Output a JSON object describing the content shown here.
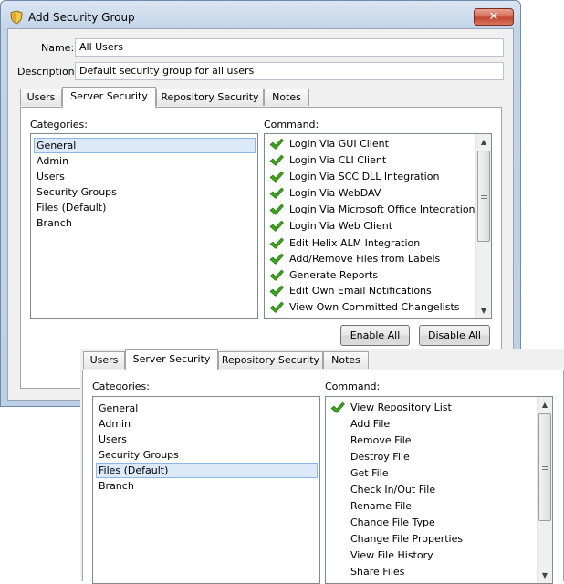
{
  "window": {
    "title": "Add Security Group",
    "close_glyph": "✕",
    "icon": "shield-icon"
  },
  "form": {
    "name_label": "Name:",
    "name_value": "All Users",
    "description_label": "Description:",
    "description_value": "Default security group for all users"
  },
  "tabs": [
    "Users",
    "Server Security",
    "Repository Security",
    "Notes"
  ],
  "active_tab": "Server Security",
  "panel": {
    "categories_label": "Categories:",
    "command_label": "Command:"
  },
  "main_view": {
    "categories": [
      "General",
      "Admin",
      "Users",
      "Security Groups",
      "Files (Default)",
      "Branch"
    ],
    "selected_category": "General",
    "commands": [
      {
        "label": "Login Via GUI Client",
        "checked": true
      },
      {
        "label": "Login Via CLI Client",
        "checked": true
      },
      {
        "label": "Login Via SCC DLL Integration",
        "checked": true
      },
      {
        "label": "Login Via WebDAV",
        "checked": true
      },
      {
        "label": "Login Via Microsoft Office Integration",
        "checked": true
      },
      {
        "label": "Login Via Web Client",
        "checked": true
      },
      {
        "label": "Edit Helix ALM Integration",
        "checked": true
      },
      {
        "label": "Add/Remove Files from Labels",
        "checked": true
      },
      {
        "label": "Generate Reports",
        "checked": true
      },
      {
        "label": "Edit Own Email Notifications",
        "checked": true
      },
      {
        "label": "View Own Committed Changelists",
        "checked": true
      }
    ]
  },
  "buttons": {
    "enable_all": "Enable All",
    "disable_all": "Disable All"
  },
  "overlay_view": {
    "categories": [
      "General",
      "Admin",
      "Users",
      "Security Groups",
      "Files (Default)",
      "Branch"
    ],
    "selected_category": "Files (Default)",
    "commands": [
      {
        "label": "View Repository List",
        "checked": true
      },
      {
        "label": "Add File",
        "checked": false
      },
      {
        "label": "Remove File",
        "checked": false
      },
      {
        "label": "Destroy File",
        "checked": false
      },
      {
        "label": "Get File",
        "checked": false
      },
      {
        "label": "Check In/Out File",
        "checked": false
      },
      {
        "label": "Rename File",
        "checked": false
      },
      {
        "label": "Change File Type",
        "checked": false
      },
      {
        "label": "Change File Properties",
        "checked": false
      },
      {
        "label": "View File History",
        "checked": false
      },
      {
        "label": "Share Files",
        "checked": false
      }
    ]
  },
  "scrollbar": {
    "up_glyph": "▲",
    "down_glyph": "▼"
  },
  "colors": {
    "check_green": "#3aa31b",
    "selection_bg": "#dce9f8"
  }
}
